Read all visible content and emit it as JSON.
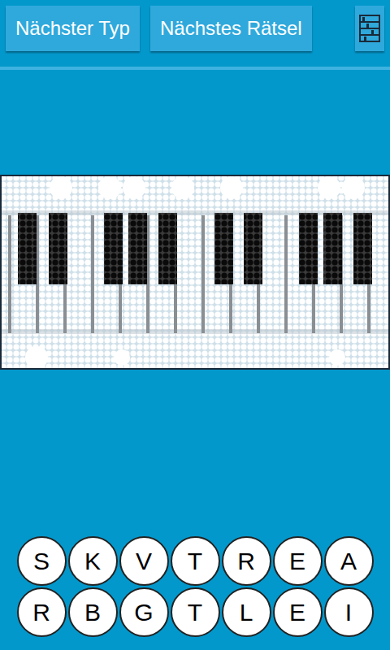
{
  "buttons": [
    {
      "label": "Nächster Typ"
    },
    {
      "label": "Nächstes Rätsel"
    }
  ],
  "letters": [
    [
      {
        "letter": "S"
      },
      {
        "letter": "K"
      },
      {
        "letter": "V"
      },
      {
        "letter": "T"
      },
      {
        "letter": "R"
      },
      {
        "letter": "E"
      },
      {
        "letter": "A"
      }
    ],
    [
      {
        "letter": "R"
      },
      {
        "letter": "B"
      },
      {
        "letter": "G"
      },
      {
        "letter": "T"
      },
      {
        "letter": "L"
      },
      {
        "letter": "E"
      },
      {
        "letter": "I"
      }
    ]
  ]
}
